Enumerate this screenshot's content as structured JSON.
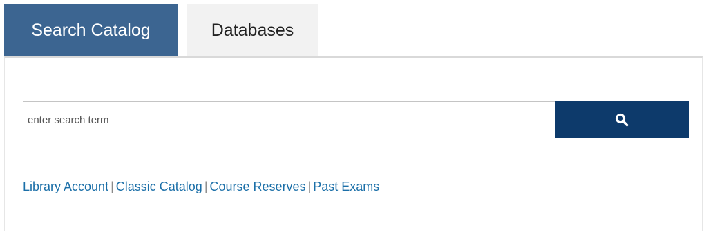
{
  "tabs": [
    {
      "label": "Search Catalog",
      "active": true
    },
    {
      "label": "Databases",
      "active": false
    }
  ],
  "search": {
    "placeholder": "enter search term",
    "value": "",
    "button_icon": "search-icon"
  },
  "links": [
    {
      "label": "Library Account"
    },
    {
      "label": "Classic Catalog"
    },
    {
      "label": "Course Reserves"
    },
    {
      "label": "Past Exams"
    }
  ],
  "separator": "|",
  "colors": {
    "active_tab": "#3c6591",
    "inactive_tab": "#f2f2f2",
    "search_button": "#0d3a6b",
    "link": "#1b6fa8"
  }
}
